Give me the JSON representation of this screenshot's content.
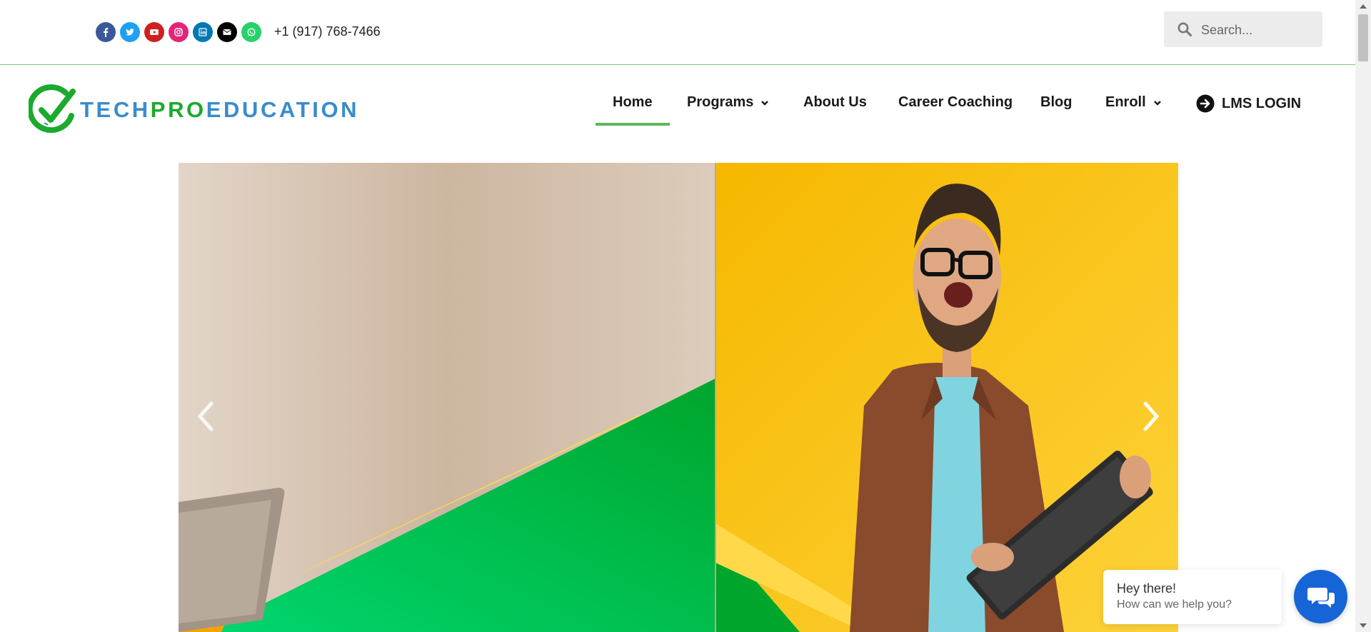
{
  "topbar": {
    "social_icons": [
      {
        "name": "facebook-icon",
        "color": "#3b5998"
      },
      {
        "name": "twitter-icon",
        "color": "#1da1f2"
      },
      {
        "name": "youtube-icon",
        "color": "#cd201f"
      },
      {
        "name": "instagram-icon",
        "color": "#e4247a"
      },
      {
        "name": "linkedin-icon",
        "color": "#0077b5"
      },
      {
        "name": "envelope-icon",
        "color": "#000000"
      },
      {
        "name": "whatsapp-icon",
        "color": "#25d366"
      }
    ],
    "phone": "+1 (917) 768-7466"
  },
  "search": {
    "placeholder": "Search..."
  },
  "logo": {
    "part1": "TECH",
    "part2": "PRO",
    "part3": "EDUCATION",
    "colors": {
      "blue": "#3a8ccc",
      "green": "#1aaa2c"
    }
  },
  "nav": {
    "items": [
      {
        "label": "Home",
        "active": true
      },
      {
        "label": "Programs",
        "dropdown": true
      },
      {
        "label": "About Us"
      },
      {
        "label": "Career Coaching"
      },
      {
        "label": "Blog"
      },
      {
        "label": "Enroll",
        "dropdown": true
      },
      {
        "label": "LMS LOGIN",
        "icon": "arrow-circle-right-icon"
      }
    ],
    "active_color": "#5cb85c"
  },
  "hero": {
    "prev_icon": "chevron-left-icon",
    "next_icon": "chevron-right-icon"
  },
  "chat": {
    "greeting": "Hey there!",
    "prompt": "How can we help you?",
    "button_icon": "chat-icon",
    "button_color": "#1565d6"
  }
}
